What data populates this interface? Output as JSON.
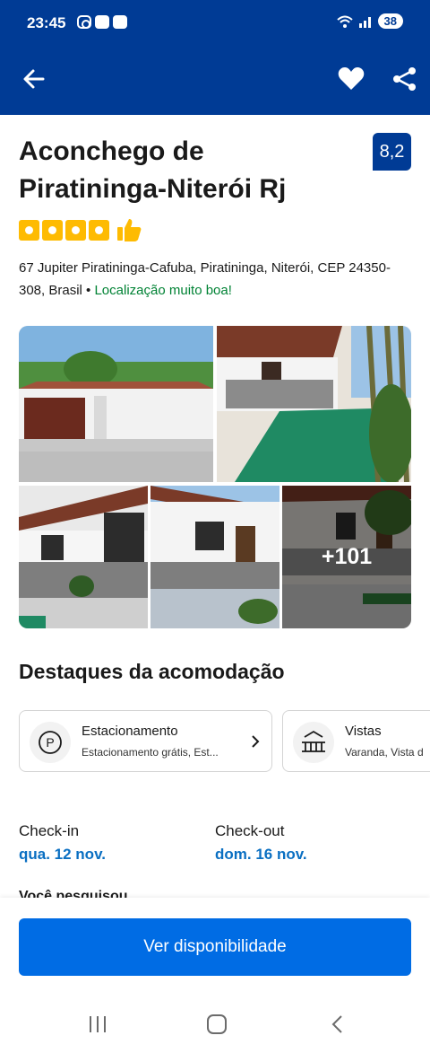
{
  "status_bar": {
    "time": "23:45",
    "battery": "38"
  },
  "app_bar": {
    "back_icon": "arrow-left-icon",
    "favorite_icon": "heart-icon",
    "share_icon": "share-icon",
    "background_color": "#003b95"
  },
  "property": {
    "title": "Aconchego de Piratininga-Niterói Rj",
    "score": "8,2",
    "stars": 4,
    "address": "67 Jupiter Piratininga-Cafuba, Piratininga, Niterói, CEP 24350-308, Brasil",
    "separator": " • ",
    "location_note": "Localização muito boa!"
  },
  "gallery": {
    "more_label": "+101"
  },
  "highlights": {
    "title": "Destaques da acomodação",
    "items": [
      {
        "icon": "parking-icon",
        "name": "Estacionamento",
        "description": "Estacionamento grátis, Est..."
      },
      {
        "icon": "balcony-view-icon",
        "name": "Vistas",
        "description": "Varanda, Vista d"
      }
    ]
  },
  "dates": {
    "checkin_label": "Check-in",
    "checkin_value": "qua. 12 nov.",
    "checkout_label": "Check-out",
    "checkout_value": "dom. 16 nov.",
    "searched_label": "Você pesquisou"
  },
  "cta": {
    "label": "Ver disponibilidade",
    "color": "#006ce4"
  },
  "colors": {
    "brand": "#003b95",
    "accent": "#006ce4",
    "star": "#febb02",
    "positive": "#008234"
  }
}
